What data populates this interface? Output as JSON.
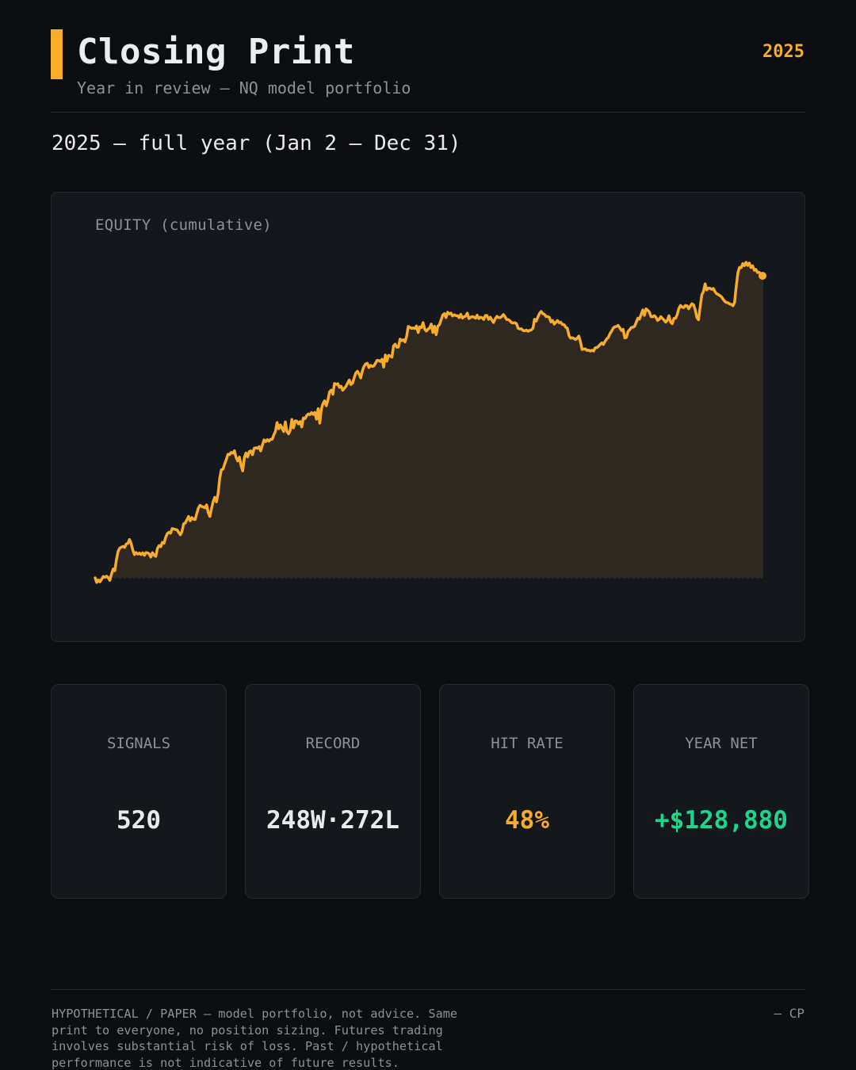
{
  "header": {
    "title": "Closing Print",
    "subtitle": "Year in review — NQ model portfolio",
    "year": "2025",
    "period": "2025 — full year (Jan 2 – Dec 31)"
  },
  "colors": {
    "accent": "#f8ac2b",
    "positive": "#19d88c",
    "background": "#0b0d10",
    "card": "#14171c"
  },
  "chart_data": {
    "type": "area",
    "title": "EQUITY (cumulative)",
    "xlabel": "",
    "ylabel": "",
    "x_range": [
      "Jan 2",
      "Dec 31"
    ],
    "baseline": 0,
    "end_value": 128880,
    "grid": false,
    "legend": "none",
    "series": [
      {
        "values": [
          0,
          -1770,
          -840,
          -1500,
          -510,
          520,
          140,
          640,
          70,
          -960,
          1420,
          3310,
          2690,
          6840,
          10000,
          11190,
          11540,
          11860,
          11460,
          12750,
          13060,
          14470,
          12940,
          10430,
          8780,
          9540,
          8920,
          9340,
          8770,
          9440,
          8480,
          9480,
          9440,
          9050,
          7840,
          9480,
          8530,
          8070,
          11010,
          12180,
          11720,
          13380,
          13060,
          15160,
          16680,
          17190,
          16840,
          18590,
          18440,
          18230,
          18080,
          17120,
          16260,
          17490,
          20390,
          20720,
          21960,
          23180,
          21510,
          22740,
          22100,
          22000,
          24300,
          26350,
          27370,
          26930,
          26730,
          26440,
          27550,
          24670,
          23180,
          26180,
          28890,
          30390,
          28670,
          31890,
          37590,
          40820,
          41020,
          42910,
          44640,
          46670,
          46550,
          47340,
          47060,
          47990,
          45420,
          44120,
          45590,
          42480,
          40370,
          45370,
          47120,
          45650,
          47690,
          47920,
          46480,
          48940,
          49110,
          48910,
          49490,
          47920,
          50010,
          52090,
          51420,
          52180,
          51630,
          52280,
          52300,
          53950,
          55370,
          58630,
          56300,
          57740,
          56520,
          55230,
          58880,
          55260,
          54350,
          55740,
          59790,
          56590,
          59250,
          59170,
          58140,
          58980,
          56960,
          60380,
          60100,
          61200,
          61860,
          61630,
          62390,
          61720,
          62460,
          59900,
          63870,
          58390,
          63830,
          65840,
          66840,
          64940,
          67230,
          70230,
          70870,
          69330,
          73390,
          73030,
          73300,
          71920,
          72370,
          70810,
          71590,
          72270,
          73560,
          74670,
          73010,
          73540,
          75540,
          77350,
          78000,
          76910,
          75490,
          78150,
          79890,
          80770,
          81010,
          79410,
          80210,
          79820,
          80010,
          81090,
          82120,
          82050,
          81680,
          82560,
          79580,
          84120,
          81790,
          84020,
          83740,
          83330,
          87560,
          88240,
          87070,
          87130,
          90130,
          89590,
          89880,
          89060,
          91280,
          94900,
          94610,
          94200,
          94370,
          94100,
          95080,
          92600,
          94760,
          94490,
          96370,
          93930,
          93180,
          93900,
          94350,
          95770,
          92640,
          95000,
          91780,
          95030,
          95580,
          97390,
          99220,
          99760,
          98260,
          100290,
          99650,
          99960,
          98880,
          99300,
          99010,
          99000,
          98270,
          99490,
          98080,
          98580,
          98810,
          99930,
          97930,
          98380,
          98620,
          98470,
          98020,
          99160,
          97900,
          98370,
          98220,
          97580,
          99040,
          99050,
          97590,
          98420,
          97330,
          96410,
          97810,
          98720,
          98300,
          98210,
          98670,
          99440,
          98570,
          97510,
          97510,
          97030,
          96350,
          96220,
          96300,
          95960,
          94230,
          93990,
          94020,
          93380,
          93260,
          93550,
          93070,
          93440,
          93590,
          94210,
          97590,
          96950,
          98430,
          99760,
          100560,
          99730,
          99510,
          98650,
          98650,
          98340,
          96600,
          97180,
          95810,
          96500,
          97110,
          96310,
          96520,
          95650,
          95600,
          94690,
          94220,
          91460,
          90490,
          90620,
          90420,
          89980,
          90480,
          91300,
          89070,
          86220,
          86380,
          86400,
          85880,
          86000,
          85610,
          85930,
          85620,
          86860,
          86940,
          87410,
          88120,
          88710,
          88100,
          89310,
          90200,
          90780,
          92180,
          93170,
          94300,
          94800,
          94900,
          95330,
          94400,
          93370,
          93830,
          90600,
          90750,
          93020,
          93640,
          94520,
          94610,
          94940,
          96470,
          98050,
          97700,
          99440,
          101160,
          99110,
          101560,
          101050,
          100390,
          98630,
          98590,
          98970,
          98450,
          97200,
          97600,
          98620,
          97940,
          97300,
          96560,
          97230,
          98950,
          96530,
          95980,
          97980,
          98030,
          99410,
          101740,
          102830,
          102210,
          102050,
          102830,
          102720,
          101610,
          102590,
          103510,
          103080,
          101170,
          98300,
          97460,
          102340,
          106870,
          108070,
          111010,
          108690,
          109400,
          109340,
          108940,
          109230,
          108180,
          107310,
          107040,
          106590,
          106110,
          105160,
          104420,
          103960,
          103870,
          103420,
          103230,
          102720,
          104000,
          110050,
          115130,
          117230,
          117120,
          118680,
          117860,
          119120,
          117940,
          118850,
          117110,
          117830,
          116140,
          116440,
          115250,
          115380,
          114350,
          114040
        ]
      }
    ]
  },
  "stats": [
    {
      "label": "SIGNALS",
      "value": "520"
    },
    {
      "label": "RECORD",
      "value": "248W·272L"
    },
    {
      "label": "HIT RATE",
      "value": "48%"
    },
    {
      "label": "YEAR NET",
      "value": "+$128,880"
    }
  ],
  "footer": {
    "disclaimer": "HYPOTHETICAL / PAPER — model portfolio, not advice. Same print to everyone, no position sizing. Futures trading involves substantial risk of loss. Past / hypothetical performance is not indicative of future results.",
    "signature": "— CP"
  }
}
